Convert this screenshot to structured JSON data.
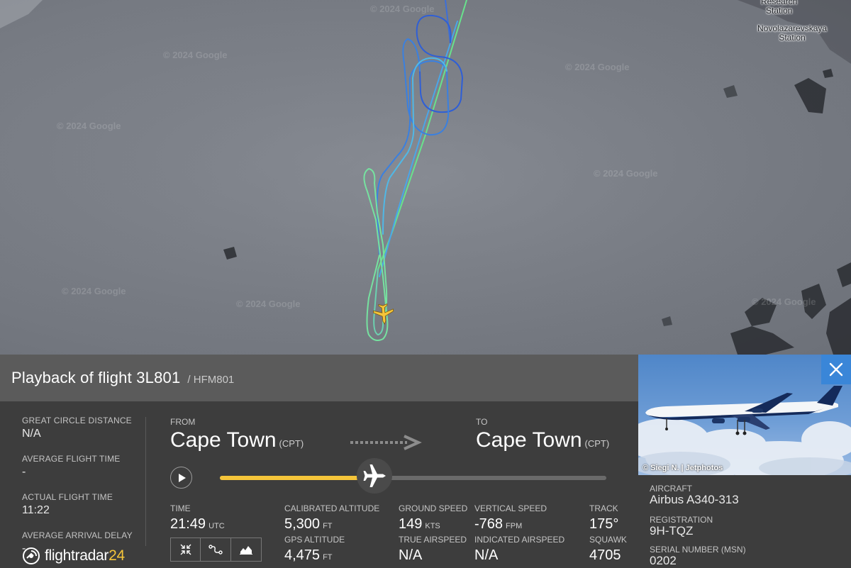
{
  "map": {
    "watermark": "© 2024 Google",
    "stations": [
      {
        "name": "Research\nStation"
      },
      {
        "name": "Novolazarevskaya\nStation"
      }
    ]
  },
  "flight": {
    "title": "Playback of flight 3L801",
    "callsign": "/ HFM801"
  },
  "stats": {
    "great_circle_distance": {
      "label": "GREAT CIRCLE DISTANCE",
      "value": "N/A"
    },
    "average_flight_time": {
      "label": "AVERAGE FLIGHT TIME",
      "value": "-"
    },
    "actual_flight_time": {
      "label": "ACTUAL FLIGHT TIME",
      "value": "11:22"
    },
    "average_arrival_delay": {
      "label": "AVERAGE ARRIVAL DELAY",
      "value": "-"
    }
  },
  "route": {
    "from_label": "FROM",
    "from_city": "Cape Town",
    "from_code": "(CPT)",
    "to_label": "TO",
    "to_city": "Cape Town",
    "to_code": "(CPT)"
  },
  "playback": {
    "progress": 0.4
  },
  "metrics": {
    "time": {
      "label": "TIME",
      "value": "21:49",
      "unit": "UTC"
    },
    "calibrated_altitude": {
      "label": "CALIBRATED ALTITUDE",
      "value": "5,300",
      "unit": "FT"
    },
    "gps_altitude": {
      "label": "GPS ALTITUDE",
      "value": "4,475",
      "unit": "FT"
    },
    "ground_speed": {
      "label": "GROUND SPEED",
      "value": "149",
      "unit": "KTS"
    },
    "true_airspeed": {
      "label": "TRUE AIRSPEED",
      "value": "N/A"
    },
    "vertical_speed": {
      "label": "VERTICAL SPEED",
      "value": "-768",
      "unit": "FPM"
    },
    "indicated_airspeed": {
      "label": "INDICATED AIRSPEED",
      "value": "N/A"
    },
    "track": {
      "label": "TRACK",
      "value": "175°"
    },
    "squawk": {
      "label": "SQUAWK",
      "value": "4705"
    }
  },
  "logo": {
    "prefix": "flightradar",
    "suffix": "24"
  },
  "aircraft": {
    "photo_credit": "© Siegi N. | Jetphotos",
    "aircraft_label": "AIRCRAFT",
    "aircraft_value": "Airbus A340-313",
    "registration_label": "REGISTRATION",
    "registration_value": "9H-TQZ",
    "serial_label": "SERIAL NUMBER (MSN)",
    "serial_value": "0202"
  },
  "colors": {
    "accent_yellow": "#f5c53a",
    "close_blue": "#3a86d8",
    "panel_bg": "#3d3d3d",
    "title_bg": "#5b5b5b"
  }
}
